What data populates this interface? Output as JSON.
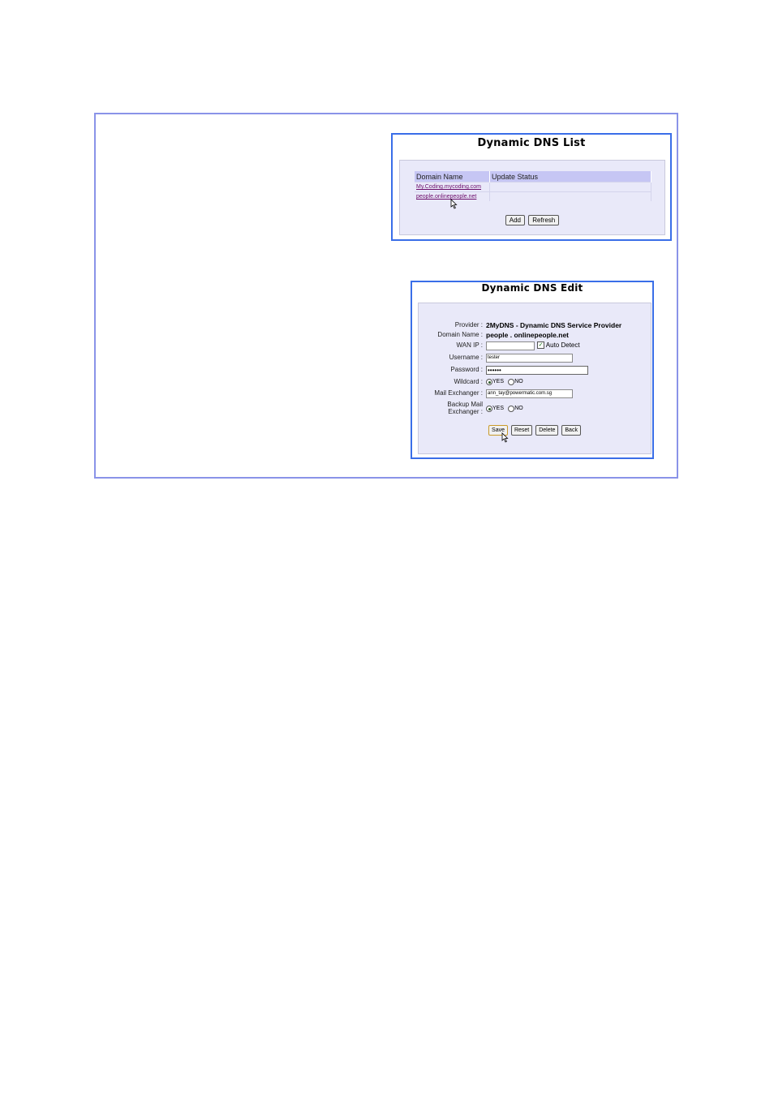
{
  "list_panel": {
    "title": "Dynamic DNS List",
    "columns": [
      "Domain Name",
      "Update Status"
    ],
    "rows": [
      {
        "domain": "My.Coding.mycoding.com",
        "status": ""
      },
      {
        "domain": "people.onlinepeople.net",
        "status": ""
      }
    ],
    "add_label": "Add",
    "refresh_label": "Refresh"
  },
  "edit_panel": {
    "title": "Dynamic DNS Edit",
    "provider_label": "Provider :",
    "provider_value": "2MyDNS - Dynamic DNS Service Provider",
    "domain_label": "Domain Name :",
    "domain_value": "people . onlinepeople.net",
    "wanip_label": "WAN IP :",
    "wanip_value": "",
    "auto_detect_label": "Auto Detect",
    "auto_detect_checked": true,
    "username_label": "Username :",
    "username_value": "tester",
    "password_label": "Password :",
    "password_value": "••••••",
    "wildcard_label": "Wildcard :",
    "yes_label": "YES",
    "no_label": "NO",
    "mail_label": "Mail Exchanger :",
    "mail_value": "ann_tay@powermatic.com.sg",
    "backup_label_1": "Backup Mail",
    "backup_label_2": "Exchanger :",
    "save_label": "Save",
    "reset_label": "Reset",
    "delete_label": "Delete",
    "back_label": "Back"
  }
}
